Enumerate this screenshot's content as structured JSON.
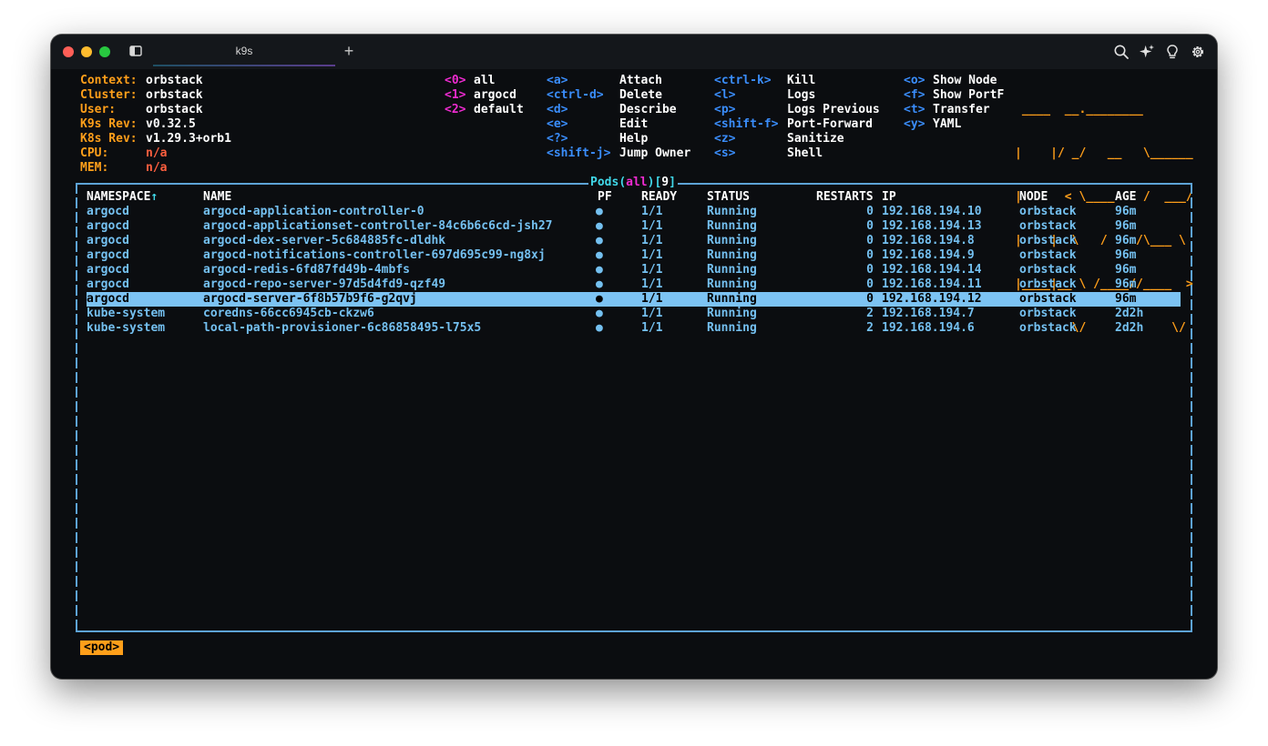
{
  "window": {
    "tab_title": "k9s",
    "new_tab_symbol": "+",
    "toolbar_icons": [
      "search-icon",
      "sparkle-icon",
      "lightbulb-icon",
      "gear-icon"
    ]
  },
  "info": {
    "context_label": "Context:",
    "context_value": "orbstack",
    "cluster_label": "Cluster:",
    "cluster_value": "orbstack",
    "user_label": "User:",
    "user_value": "orbstack",
    "k9s_rev_label": "K9s Rev:",
    "k9s_rev_value": "v0.32.5",
    "k8s_rev_label": "K8s Rev:",
    "k8s_rev_value": "v1.29.3+orb1",
    "cpu_label": "CPU:",
    "cpu_value": "n/a",
    "mem_label": "MEM:",
    "mem_value": "n/a"
  },
  "namespaces": [
    {
      "key": "<0>",
      "label": "all"
    },
    {
      "key": "<1>",
      "label": "argocd"
    },
    {
      "key": "<2>",
      "label": "default"
    }
  ],
  "shortcuts_col1": [
    {
      "key": "<a>",
      "label": "Attach"
    },
    {
      "key": "<ctrl-d>",
      "label": "Delete"
    },
    {
      "key": "<d>",
      "label": "Describe"
    },
    {
      "key": "<e>",
      "label": "Edit"
    },
    {
      "key": "<?>",
      "label": "Help"
    },
    {
      "key": "<shift-j>",
      "label": "Jump Owner"
    }
  ],
  "shortcuts_col2": [
    {
      "key": "<ctrl-k>",
      "label": "Kill"
    },
    {
      "key": "<l>",
      "label": "Logs"
    },
    {
      "key": "<p>",
      "label": "Logs Previous"
    },
    {
      "key": "<shift-f>",
      "label": "Port-Forward"
    },
    {
      "key": "<z>",
      "label": "Sanitize"
    },
    {
      "key": "<s>",
      "label": "Shell"
    }
  ],
  "shortcuts_col3": [
    {
      "key": "<o>",
      "label": "Show Node"
    },
    {
      "key": "<f>",
      "label": "Show PortF"
    },
    {
      "key": "<t>",
      "label": "Transfer"
    },
    {
      "key": "<y>",
      "label": "YAML"
    }
  ],
  "logo_lines": [
    " ____  __.________       ",
    "|    |/ _/   __   \\______",
    "|      < \\____    /  ___/",
    "|    |  \\   /    /\\___ \\ ",
    "|____|__ \\ /____//____  >",
    "        \\/            \\/ "
  ],
  "table": {
    "title_resource": "Pods",
    "title_open": "(",
    "title_namespace": "all",
    "title_close": ")",
    "title_count_open": "[",
    "title_count": "9",
    "title_count_close": "]",
    "columns": {
      "namespace": "NAMESPACE",
      "sort_arrow": "↑",
      "name": "NAME",
      "pf": "PF",
      "ready": "READY",
      "status": "STATUS",
      "restarts": "RESTARTS",
      "ip": "IP",
      "node": "NODE",
      "age": "AGE"
    },
    "rows": [
      {
        "namespace": "argocd",
        "name": "argocd-application-controller-0",
        "pf": "●",
        "ready": "1/1",
        "status": "Running",
        "restarts": "0",
        "ip": "192.168.194.10",
        "node": "orbstack",
        "age": "96m"
      },
      {
        "namespace": "argocd",
        "name": "argocd-applicationset-controller-84c6b6c6cd-jsh27",
        "pf": "●",
        "ready": "1/1",
        "status": "Running",
        "restarts": "0",
        "ip": "192.168.194.13",
        "node": "orbstack",
        "age": "96m"
      },
      {
        "namespace": "argocd",
        "name": "argocd-dex-server-5c684885fc-dldhk",
        "pf": "●",
        "ready": "1/1",
        "status": "Running",
        "restarts": "0",
        "ip": "192.168.194.8",
        "node": "orbstack",
        "age": "96m"
      },
      {
        "namespace": "argocd",
        "name": "argocd-notifications-controller-697d695c99-ng8xj",
        "pf": "●",
        "ready": "1/1",
        "status": "Running",
        "restarts": "0",
        "ip": "192.168.194.9",
        "node": "orbstack",
        "age": "96m"
      },
      {
        "namespace": "argocd",
        "name": "argocd-redis-6fd87fd49b-4mbfs",
        "pf": "●",
        "ready": "1/1",
        "status": "Running",
        "restarts": "0",
        "ip": "192.168.194.14",
        "node": "orbstack",
        "age": "96m"
      },
      {
        "namespace": "argocd",
        "name": "argocd-repo-server-97d5d4fd9-qzf49",
        "pf": "●",
        "ready": "1/1",
        "status": "Running",
        "restarts": "0",
        "ip": "192.168.194.11",
        "node": "orbstack",
        "age": "96m"
      },
      {
        "namespace": "argocd",
        "name": "argocd-server-6f8b57b9f6-g2qvj",
        "pf": "●",
        "ready": "1/1",
        "status": "Running",
        "restarts": "0",
        "ip": "192.168.194.12",
        "node": "orbstack",
        "age": "96m",
        "selected": true
      },
      {
        "namespace": "kube-system",
        "name": "coredns-66cc6945cb-ckzw6",
        "pf": "●",
        "ready": "1/1",
        "status": "Running",
        "restarts": "2",
        "ip": "192.168.194.7",
        "node": "orbstack",
        "age": "2d2h"
      },
      {
        "namespace": "kube-system",
        "name": "local-path-provisioner-6c86858495-l75x5",
        "pf": "●",
        "ready": "1/1",
        "status": "Running",
        "restarts": "2",
        "ip": "192.168.194.6",
        "node": "orbstack",
        "age": "2d2h"
      }
    ]
  },
  "breadcrumb": "<pod>",
  "colors": {
    "label_orange": "#ff9f1a",
    "namespace_key_magenta": "#ee2bd0",
    "shortcut_key_blue": "#3a8dfb",
    "row_text": "#74c0f0",
    "selected_row_bg": "#7cc3f3",
    "frame_border": "#5da3d6"
  }
}
